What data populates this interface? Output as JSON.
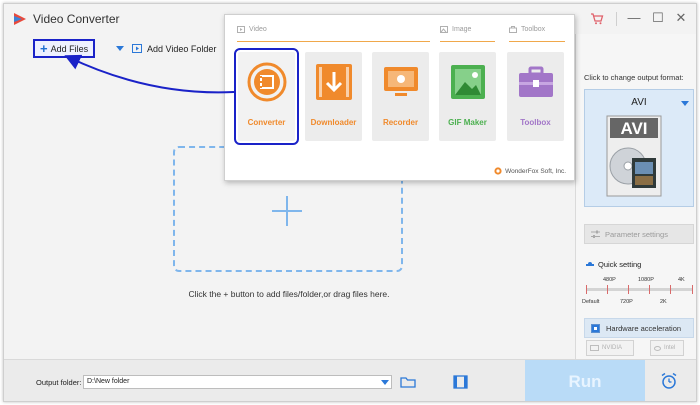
{
  "app": {
    "title": "Video Converter"
  },
  "window_controls": {
    "minimize": "—",
    "maximize": "☐",
    "close": "✕"
  },
  "toolbar": {
    "add_files": "Add Files",
    "add_video_folder": "Add Video Folder"
  },
  "drop_zone": {
    "hint": "Click the + button to add files/folder,or drag files here."
  },
  "overlay": {
    "categories": {
      "video": "Video",
      "image": "Image",
      "toolbox": "Toolbox"
    },
    "tiles": [
      {
        "label": "Converter",
        "color": "#f08a2c"
      },
      {
        "label": "Downloader",
        "color": "#f08a2c"
      },
      {
        "label": "Recorder",
        "color": "#f08a2c"
      },
      {
        "label": "GIF Maker",
        "color": "#4cb050"
      },
      {
        "label": "Toolbox",
        "color": "#a276c8"
      }
    ],
    "footer": "WonderFox Soft, Inc."
  },
  "right_panel": {
    "output_format_label": "Click to change output format:",
    "format": "AVI",
    "parameter_settings": "Parameter settings",
    "quick_setting": "Quick setting",
    "quality_ticks_top": [
      "480P",
      "1080P",
      "4K"
    ],
    "quality_ticks_bottom": [
      "Default",
      "720P",
      "2K"
    ],
    "hardware_acceleration": "Hardware acceleration",
    "gpu_options": [
      "NVIDIA",
      "Intel"
    ]
  },
  "bottom": {
    "output_folder_label": "Output folder:",
    "output_folder_value": "D:\\New folder",
    "run": "Run"
  }
}
